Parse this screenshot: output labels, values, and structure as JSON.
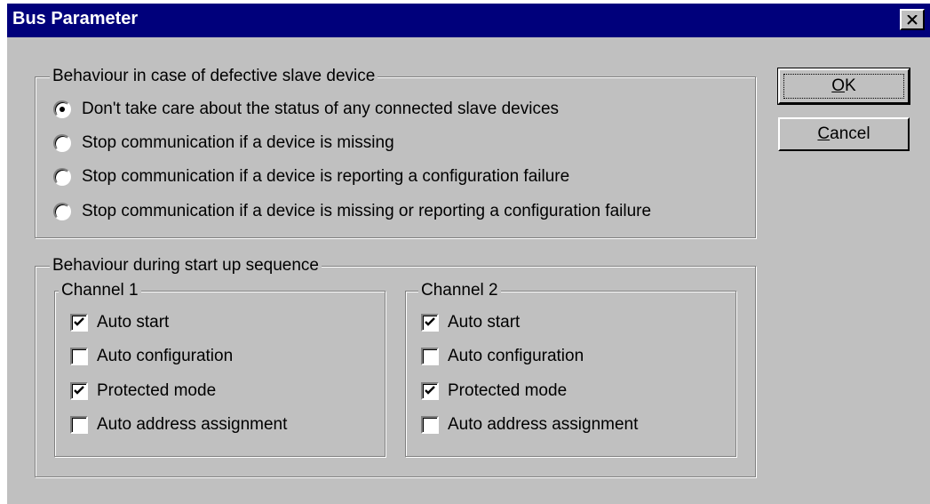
{
  "window": {
    "title": "Bus Parameter"
  },
  "buttons": {
    "ok": {
      "mnemonic": "O",
      "rest": "K"
    },
    "cancel": {
      "mnemonic": "C",
      "rest": "ancel"
    }
  },
  "defective_group": {
    "legend": "Behaviour in case of defective slave device",
    "selected_index": 0,
    "options": [
      "Don't take care about the status of any connected slave devices",
      "Stop communication if a device is missing",
      "Stop communication if a device is reporting a configuration failure",
      "Stop communication if a device is missing or reporting a configuration failure"
    ]
  },
  "startup_group": {
    "legend": "Behaviour during start up sequence",
    "channels": [
      {
        "legend": "Channel 1",
        "options": [
          {
            "label": "Auto start",
            "checked": true
          },
          {
            "label": "Auto configuration",
            "checked": false
          },
          {
            "label": "Protected mode",
            "checked": true
          },
          {
            "label": "Auto address assignment",
            "checked": false
          }
        ]
      },
      {
        "legend": "Channel 2",
        "options": [
          {
            "label": "Auto start",
            "checked": true
          },
          {
            "label": "Auto configuration",
            "checked": false
          },
          {
            "label": "Protected mode",
            "checked": true
          },
          {
            "label": "Auto address assignment",
            "checked": false
          }
        ]
      }
    ]
  }
}
